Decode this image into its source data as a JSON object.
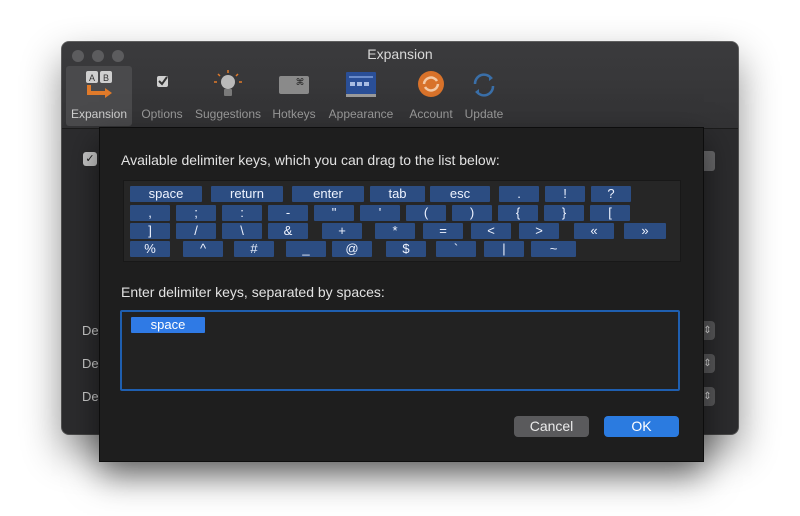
{
  "window": {
    "title": "Expansion",
    "toolbar": [
      {
        "label": "Expansion",
        "icon": "expansion-icon",
        "selected": true
      },
      {
        "label": "Options",
        "icon": "checkbox-icon"
      },
      {
        "label": "Suggestions",
        "icon": "lightbulb-icon"
      },
      {
        "label": "Hotkeys",
        "icon": "command-key-icon"
      },
      {
        "label": "Appearance",
        "icon": "display-icon"
      },
      {
        "label": "Account",
        "icon": "account-sync-icon"
      },
      {
        "label": "Update",
        "icon": "update-icon"
      }
    ],
    "background_rows": [
      {
        "label": "De"
      },
      {
        "label": "De"
      },
      {
        "label": "De"
      }
    ],
    "checkbox_mark": "✓",
    "stepper_glyph": "⇕"
  },
  "sheet": {
    "available_heading": "Available delimiter keys, which you can drag to the list below:",
    "key_rows": [
      [
        "space",
        "return",
        "enter",
        "tab",
        "esc",
        ".",
        "!",
        "?"
      ],
      [
        ",",
        ";",
        ":",
        "-",
        "\"",
        "'",
        "(",
        ")",
        "{",
        "}",
        "["
      ],
      [
        "]",
        "/",
        "\\",
        "&",
        "+",
        "*",
        "=",
        "<",
        ">",
        "«",
        "»"
      ],
      [
        "%",
        "^",
        "#",
        "_",
        "@",
        "$",
        "`",
        "|",
        "~"
      ]
    ],
    "entry_heading": "Enter delimiter keys, separated by spaces:",
    "entered_keys": [
      "space"
    ],
    "cancel_label": "Cancel",
    "ok_label": "OK"
  },
  "colors": {
    "key_background": "#2c4d82",
    "token_background": "#2f7ae5",
    "ok_button": "#2b7be0",
    "field_border": "#1f5fb0"
  }
}
